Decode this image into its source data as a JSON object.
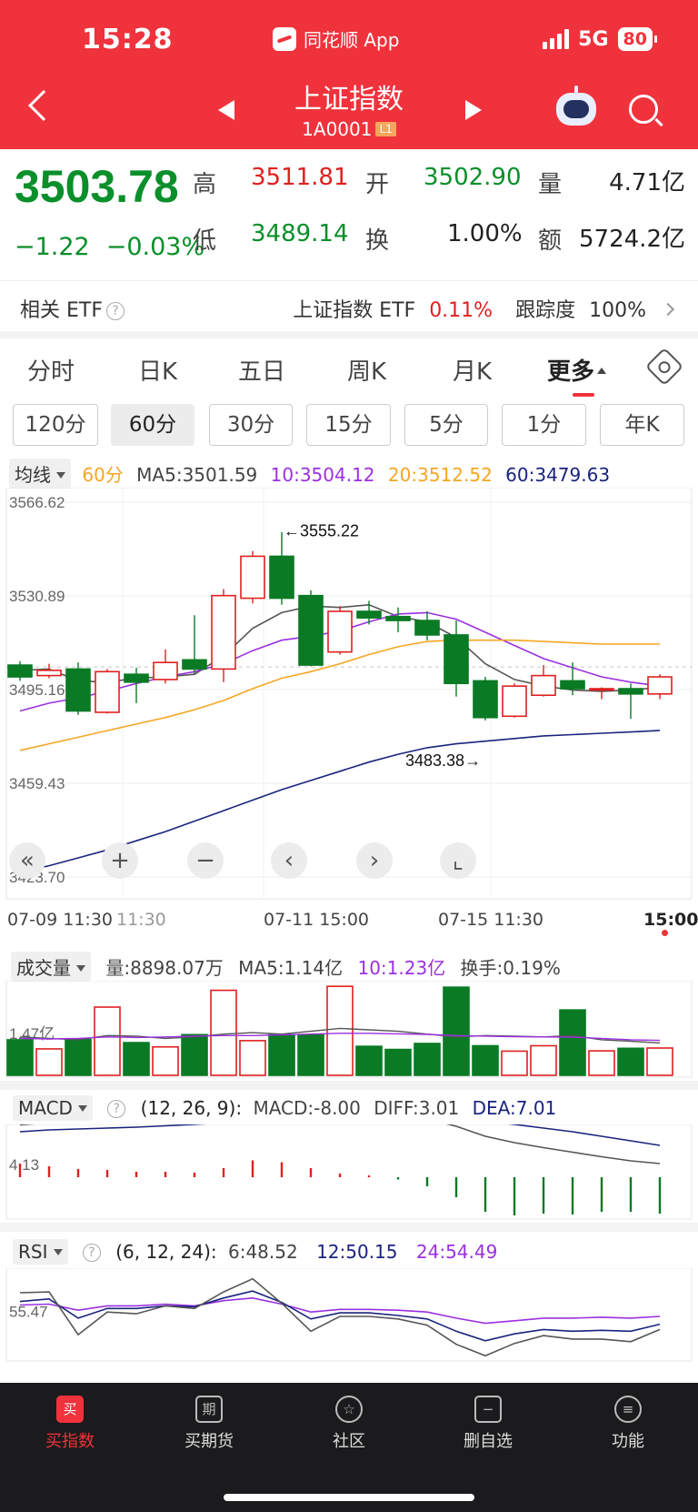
{
  "status_bar": {
    "time": "15:28",
    "app_name": "同花顺 App",
    "network": "5G",
    "battery": "80"
  },
  "nav": {
    "title": "上证指数",
    "code": "1A0001",
    "level": "L1"
  },
  "quote": {
    "price": "3503.78",
    "change": "−1.22",
    "change_pct": "−0.03%",
    "high_label": "高",
    "high": "3511.81",
    "low_label": "低",
    "low": "3489.14",
    "open_label": "开",
    "open": "3502.90",
    "turnover_label": "换",
    "turnover": "1.00%",
    "volume_label": "量",
    "volume": "4.71亿",
    "amount_label": "额",
    "amount": "5724.2亿"
  },
  "etf": {
    "label": "相关 ETF",
    "name": "上证指数 ETF",
    "pct": "0.11%",
    "track_label": "跟踪度",
    "track": "100%"
  },
  "tabs": [
    "分时",
    "日K",
    "五日",
    "周K",
    "月K",
    "更多"
  ],
  "periods": [
    "120分",
    "60分",
    "30分",
    "15分",
    "5分",
    "1分",
    "年K"
  ],
  "ma_bar": {
    "mode": "均线",
    "period": "60分",
    "ma5": "MA5:3501.59",
    "ma10": "10:3504.12",
    "ma20": "20:3512.52",
    "ma60": "60:3479.63"
  },
  "chart_data": {
    "type": "candlestick",
    "y_ticks": [
      "3566.62",
      "3530.89",
      "3495.16",
      "3459.43",
      "3423.70"
    ],
    "ylim": [
      3423.7,
      3566.62
    ],
    "x_ticks": [
      "07-09 11:30",
      "11:30",
      "07-11 15:00",
      "07-15 11:30",
      "15:00"
    ],
    "annotations": {
      "high": "←3555.22",
      "low": "3483.38→"
    },
    "candles": [
      {
        "o": 3504.5,
        "c": 3500.0,
        "h": 3506.0,
        "l": 3498.5
      },
      {
        "o": 3500.5,
        "c": 3502.5,
        "h": 3505.0,
        "l": 3499.5
      },
      {
        "o": 3503.0,
        "c": 3487.0,
        "h": 3505.5,
        "l": 3485.5
      },
      {
        "o": 3486.5,
        "c": 3502.0,
        "h": 3503.0,
        "l": 3486.0
      },
      {
        "o": 3501.0,
        "c": 3498.0,
        "h": 3503.5,
        "l": 3490.0
      },
      {
        "o": 3499.0,
        "c": 3505.5,
        "h": 3510.5,
        "l": 3497.5
      },
      {
        "o": 3506.5,
        "c": 3503.0,
        "h": 3523.5,
        "l": 3501.0
      },
      {
        "o": 3503.0,
        "c": 3531.0,
        "h": 3533.5,
        "l": 3498.0
      },
      {
        "o": 3530.0,
        "c": 3546.0,
        "h": 3548.0,
        "l": 3528.0
      },
      {
        "o": 3546.0,
        "c": 3530.0,
        "h": 3555.2,
        "l": 3527.5
      },
      {
        "o": 3531.0,
        "c": 3504.5,
        "h": 3533.0,
        "l": 3504.0
      },
      {
        "o": 3509.5,
        "c": 3525.0,
        "h": 3527.0,
        "l": 3508.5
      },
      {
        "o": 3525.0,
        "c": 3522.5,
        "h": 3529.0,
        "l": 3520.0
      },
      {
        "o": 3523.0,
        "c": 3521.5,
        "h": 3526.5,
        "l": 3517.0
      },
      {
        "o": 3521.5,
        "c": 3516.0,
        "h": 3525.0,
        "l": 3514.0
      },
      {
        "o": 3516.0,
        "c": 3497.5,
        "h": 3521.5,
        "l": 3492.5
      },
      {
        "o": 3498.5,
        "c": 3484.5,
        "h": 3500.0,
        "l": 3483.4
      },
      {
        "o": 3485.0,
        "c": 3496.5,
        "h": 3497.5,
        "l": 3484.5
      },
      {
        "o": 3493.0,
        "c": 3500.5,
        "h": 3504.5,
        "l": 3492.5
      },
      {
        "o": 3498.5,
        "c": 3495.5,
        "h": 3505.5,
        "l": 3493.0
      },
      {
        "o": 3495.5,
        "c": 3495.5,
        "h": 3496.0,
        "l": 3491.5
      },
      {
        "o": 3495.5,
        "c": 3493.5,
        "h": 3497.5,
        "l": 3484.0
      },
      {
        "o": 3493.5,
        "c": 3500.0,
        "h": 3501.0,
        "l": 3491.5
      }
    ],
    "series": [
      {
        "name": "MA5",
        "color": "#555555",
        "values": [
          3502.5,
          3503.0,
          3498.5,
          3498.0,
          3499.5,
          3500.0,
          3501.0,
          3508.0,
          3518.5,
          3524.5,
          3527.0,
          3526.5,
          3527.5,
          3523.0,
          3521.0,
          3515.0,
          3505.0,
          3499.0,
          3496.5,
          3495.0,
          3494.5,
          3495.0,
          3496.0
        ]
      },
      {
        "name": "MA10",
        "color": "#9b30e0",
        "values": [
          3487.0,
          3490.0,
          3492.0,
          3494.5,
          3497.5,
          3500.0,
          3502.0,
          3505.0,
          3510.0,
          3514.0,
          3515.5,
          3517.5,
          3521.0,
          3524.0,
          3524.5,
          3522.0,
          3517.0,
          3512.0,
          3507.0,
          3503.5,
          3500.0,
          3498.0,
          3496.5
        ]
      },
      {
        "name": "MA20",
        "color": "#f5a623",
        "values": [
          3472.0,
          3474.5,
          3477.0,
          3479.5,
          3482.0,
          3484.5,
          3487.5,
          3491.0,
          3495.5,
          3499.5,
          3502.0,
          3505.0,
          3508.5,
          3511.5,
          3513.5,
          3514.0,
          3514.0,
          3514.0,
          3513.5,
          3513.0,
          3512.5,
          3512.5,
          3512.5
        ]
      },
      {
        "name": "MA60",
        "color": "#1a237e",
        "values": [
          3425.5,
          3428.0,
          3431.0,
          3434.0,
          3437.5,
          3441.0,
          3445.0,
          3449.0,
          3453.0,
          3457.0,
          3460.5,
          3464.0,
          3467.5,
          3470.5,
          3473.0,
          3474.5,
          3475.5,
          3476.5,
          3477.5,
          3478.0,
          3478.5,
          3479.0,
          3479.6
        ]
      }
    ],
    "volume": {
      "label": "成交量",
      "tick": "1.47亿",
      "vol_text": "量:8898.07万",
      "ma5_text": "MA5:1.14亿",
      "ma10_text": "10:1.23亿",
      "turnover_text": "换手:0.19%",
      "values": [
        1.25,
        0.93,
        1.26,
        2.4,
        1.15,
        1.0,
        1.43,
        2.99,
        1.22,
        1.43,
        1.43,
        3.13,
        1.02,
        0.91,
        1.12,
        3.1,
        1.04,
        0.85,
        1.04,
        2.3,
        0.86,
        0.95,
        0.96
      ],
      "ma5": [
        1.35,
        1.3,
        1.25,
        1.4,
        1.38,
        1.3,
        1.35,
        1.45,
        1.5,
        1.45,
        1.55,
        1.65,
        1.6,
        1.55,
        1.45,
        1.35,
        1.4,
        1.38,
        1.35,
        1.4,
        1.25,
        1.2,
        1.14
      ],
      "ma10": [
        1.3,
        1.28,
        1.3,
        1.35,
        1.33,
        1.35,
        1.38,
        1.4,
        1.4,
        1.42,
        1.45,
        1.48,
        1.48,
        1.46,
        1.44,
        1.4,
        1.38,
        1.36,
        1.35,
        1.34,
        1.3,
        1.25,
        1.23
      ]
    },
    "macd": {
      "label": "MACD",
      "params": "(12, 26, 9):",
      "macd_text": "MACD:-8.00",
      "diff_text": "DIFF:3.01",
      "dea_text": "DEA:7.01",
      "tick": "4.13",
      "bars": [
        3.0,
        2.4,
        1.8,
        1.6,
        1.2,
        1.2,
        1.0,
        2.0,
        3.7,
        3.3,
        2.0,
        0.8,
        0.4,
        -0.5,
        -2.0,
        -4.4,
        -7.6,
        -8.4,
        -8.0,
        -8.2,
        -7.6,
        -7.6,
        -8.0
      ],
      "diff": [
        11.5,
        12.0,
        12.0,
        12.0,
        12.0,
        12.2,
        12.5,
        13.2,
        15.0,
        15.6,
        14.8,
        14.2,
        14.0,
        13.6,
        12.8,
        11.2,
        9.0,
        7.6,
        6.5,
        5.5,
        4.5,
        3.6,
        3.0
      ],
      "dea": [
        10.0,
        10.4,
        10.6,
        10.8,
        11.0,
        11.3,
        11.6,
        12.0,
        12.8,
        13.3,
        13.6,
        13.8,
        13.8,
        13.7,
        13.3,
        12.9,
        12.3,
        11.6,
        10.8,
        10.0,
        9.0,
        8.0,
        7.0
      ]
    },
    "rsi": {
      "label": "RSI",
      "params": "(6, 12, 24):",
      "rsi6_text": "6:48.52",
      "rsi12_text": "12:50.15",
      "rsi24_text": "24:54.49",
      "tick": "55.47",
      "rsi6": [
        66.0,
        66.5,
        42.0,
        55.0,
        54.0,
        58.5,
        57.0,
        66.5,
        74.0,
        60.0,
        44.0,
        52.5,
        52.5,
        51.0,
        47.5,
        36.5,
        30.0,
        37.0,
        41.5,
        39.5,
        39.5,
        38.0,
        45.0
      ],
      "rsi12": [
        61.0,
        62.5,
        51.5,
        57.0,
        57.0,
        58.5,
        58.0,
        63.0,
        67.0,
        60.5,
        51.0,
        54.5,
        54.5,
        53.0,
        51.0,
        44.0,
        38.5,
        42.5,
        45.0,
        44.0,
        44.5,
        44.0,
        48.0
      ],
      "rsi24": [
        59.0,
        59.5,
        56.0,
        58.5,
        58.5,
        59.5,
        58.5,
        61.5,
        63.0,
        59.5,
        55.0,
        56.5,
        56.5,
        56.0,
        55.0,
        51.5,
        48.5,
        50.0,
        51.5,
        51.5,
        52.0,
        51.5,
        52.5
      ]
    }
  },
  "chart_tools": [
    "«",
    "+",
    "−",
    "‹",
    "›",
    "⌞"
  ],
  "bottom_nav": [
    {
      "label": "买指数",
      "icon": "买"
    },
    {
      "label": "买期货",
      "icon": "期"
    },
    {
      "label": "社区",
      "icon": "☆"
    },
    {
      "label": "删自选",
      "icon": "−"
    },
    {
      "label": "功能",
      "icon": "≡"
    }
  ],
  "colors": {
    "up": "#e02020",
    "down": "#0a7a24",
    "accent": "#f0323c"
  }
}
